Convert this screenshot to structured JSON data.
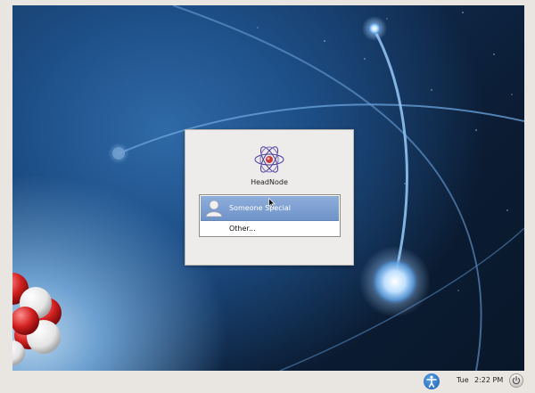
{
  "login": {
    "host_name": "HeadNode",
    "users": [
      {
        "name": "Someone Special",
        "selected": true
      }
    ],
    "other_label": "Other..."
  },
  "panel": {
    "day": "Tue",
    "time": "2:22 PM",
    "accessibility_icon": "accessibility-icon",
    "power_icon": "power-icon"
  },
  "colors": {
    "selection": "#7c9dd1",
    "desktop_dark": "#0b1c33",
    "desktop_mid": "#1d4e86"
  }
}
